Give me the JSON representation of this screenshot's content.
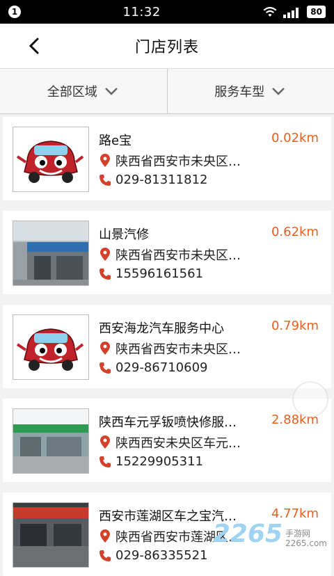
{
  "status": {
    "notification": "1",
    "time": "11:32",
    "battery": "80"
  },
  "header": {
    "title": "门店列表"
  },
  "filters": {
    "region": "全部区域",
    "service": "服务车型"
  },
  "stores": [
    {
      "name": "路e宝",
      "address": "陕西省西安市未央区…",
      "phone": "029-81311812",
      "distance": "0.02km",
      "thumb": "car-mascot"
    },
    {
      "name": "山景汽修",
      "address": "陕西省西安市未央区…",
      "phone": "15596161561",
      "distance": "0.62km",
      "thumb": "shop-front"
    },
    {
      "name": "西安海龙汽车服务中心",
      "address": "陕西省西安市未央区…",
      "phone": "029-86710609",
      "distance": "0.79km",
      "thumb": "car-mascot"
    },
    {
      "name": "陕西车元孚钣喷快修服…",
      "address": "陕西西安未央区车元…",
      "phone": "15229905311",
      "distance": "2.88km",
      "thumb": "shop-front-green"
    },
    {
      "name": "西安市莲湖区车之宝汽…",
      "address": "陕西省西安市莲湖区…",
      "phone": "029-86335521",
      "distance": "4.77km",
      "thumb": "shop-front-red"
    }
  ],
  "watermark": {
    "brand": "2265",
    "domain": "2265.com",
    "label": "手游网"
  },
  "colors": {
    "accent": "#e8601c",
    "icon": "#d4412b"
  }
}
